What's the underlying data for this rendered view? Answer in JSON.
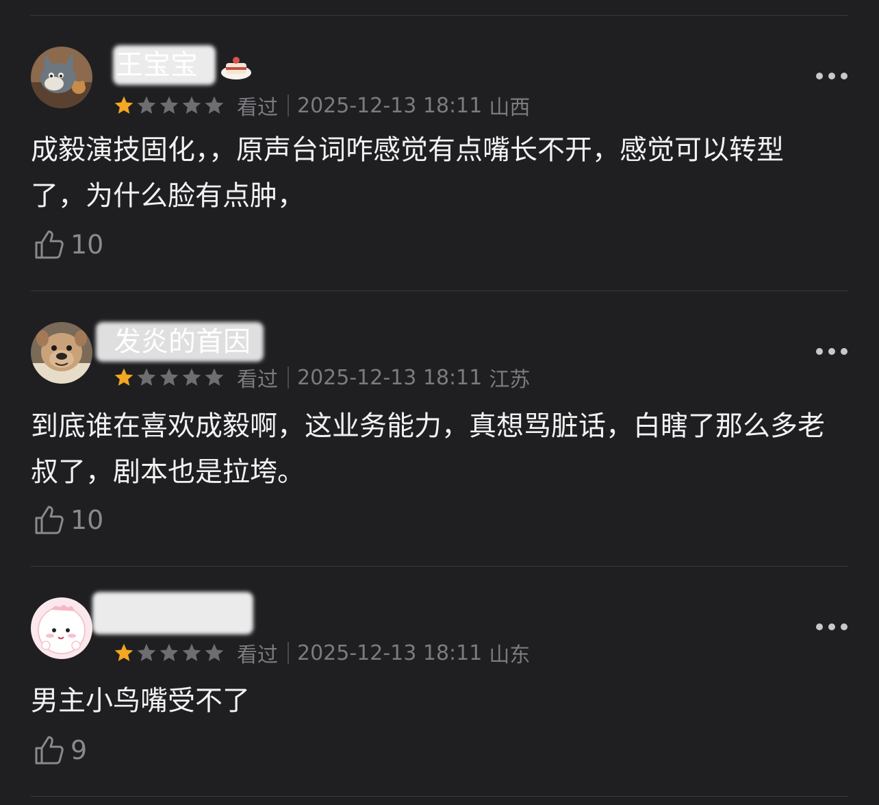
{
  "colors": {
    "background": "#1f1f22",
    "divider": "#3a3a3e",
    "star_active": "#f5a623",
    "star_inactive": "#6e6e72",
    "meta_text": "#7c7c80",
    "body_text": "#f2f2f2"
  },
  "comments": [
    {
      "username": "王宝宝",
      "avatar_icon": "cartoon-cat-avatar-icon",
      "badge_icon": "cake-badge-icon",
      "rating": 1,
      "rating_max": 5,
      "status": "看过",
      "datetime": "2025-12-13 18:11",
      "location": "山西",
      "text": " 成毅演技固化，，原声台词咋感觉有点嘴长不开，感觉可以转型了，为什么脸有点肿，",
      "likes": "10"
    },
    {
      "username": "发炎的首因",
      "avatar_icon": "bulldog-avatar-icon",
      "rating": 1,
      "rating_max": 5,
      "status": "看过",
      "datetime": "2025-12-13 18:11",
      "location": "江苏",
      "text": "到底谁在喜欢成毅啊，这业务能力，真想骂脏话，白瞎了那么多老叔了，剧本也是拉垮。",
      "likes": "10"
    },
    {
      "username": "",
      "avatar_icon": "pink-blob-avatar-icon",
      "rating": 1,
      "rating_max": 5,
      "status": "看过",
      "datetime": "2025-12-13 18:11",
      "location": "山东",
      "text": "男主小鸟嘴受不了",
      "likes": "9"
    }
  ]
}
